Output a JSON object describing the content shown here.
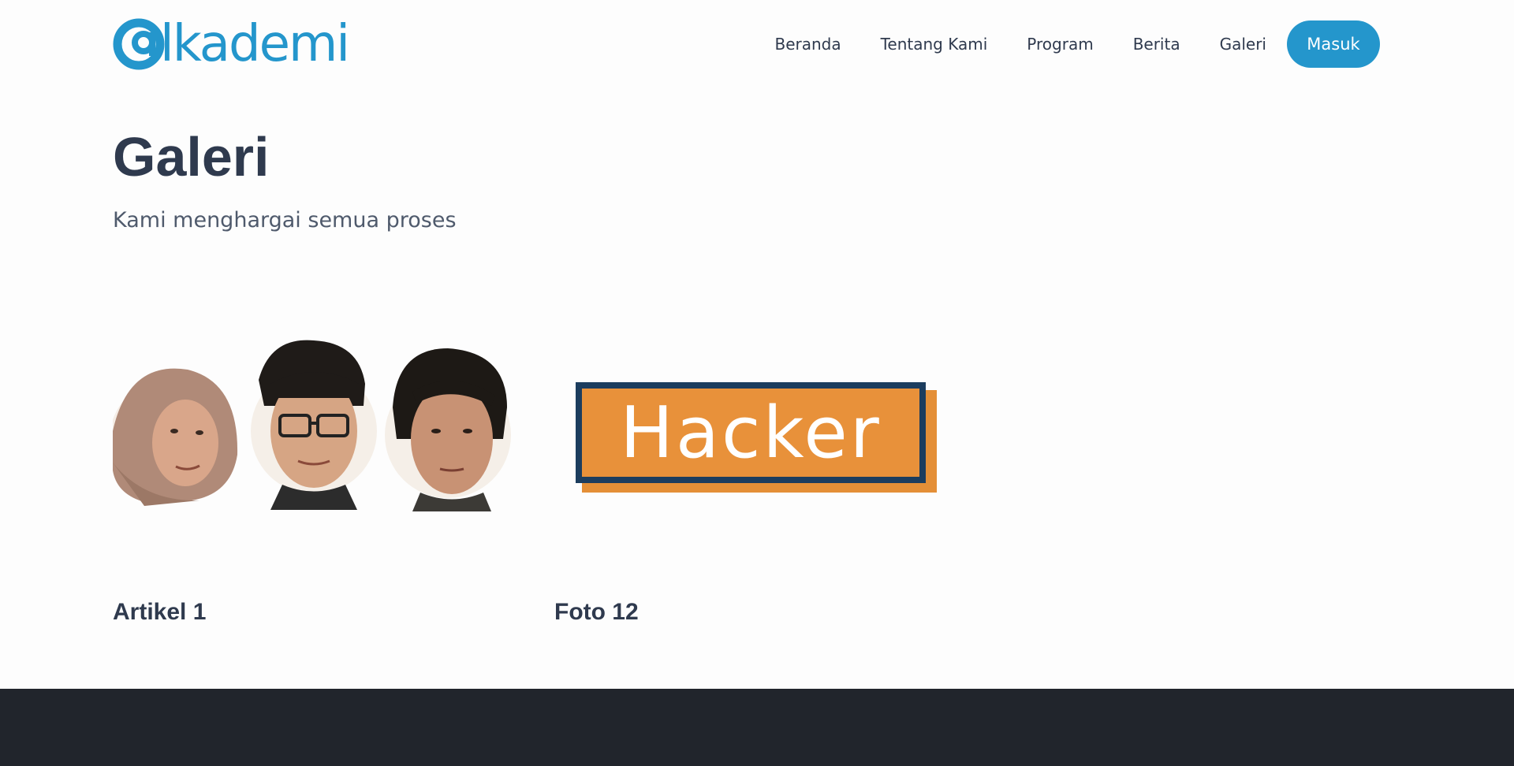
{
  "brand": {
    "logo_text": "lkademi",
    "accent_color": "#2496cc"
  },
  "nav": {
    "items": [
      {
        "label": "Beranda"
      },
      {
        "label": "Tentang Kami"
      },
      {
        "label": "Program"
      },
      {
        "label": "Berita"
      },
      {
        "label": "Galeri"
      }
    ],
    "login_label": "Masuk"
  },
  "page": {
    "title": "Galeri",
    "subtitle": "Kami menghargai semua proses"
  },
  "gallery": {
    "items": [
      {
        "caption": "Artikel 1",
        "image": "three-portraits"
      },
      {
        "caption": "Foto 12",
        "image_text": "Hacker"
      }
    ]
  },
  "footer": {
    "color": "#21252c"
  }
}
